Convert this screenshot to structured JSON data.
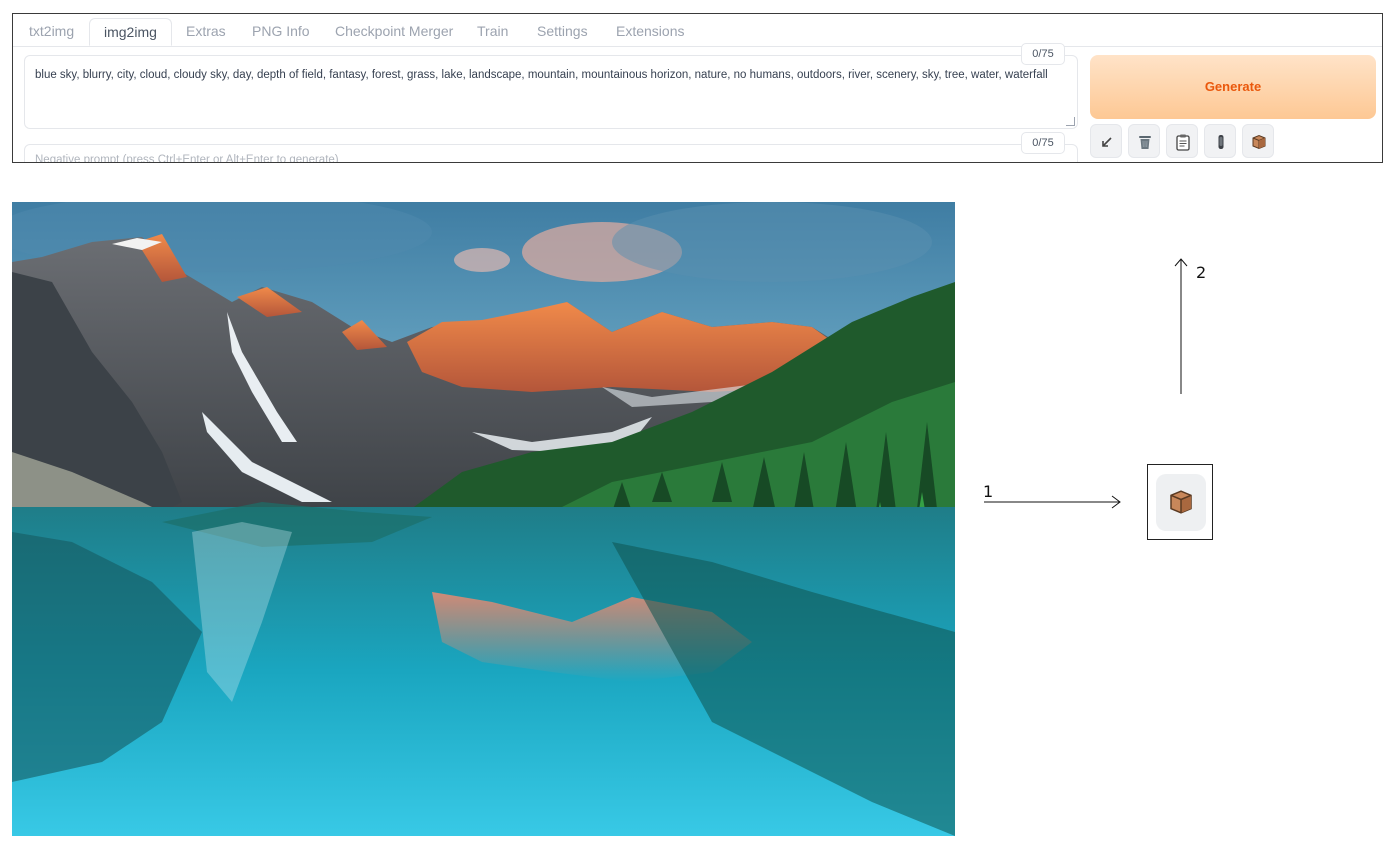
{
  "tabs": [
    {
      "label": "txt2img"
    },
    {
      "label": "img2img",
      "active": true
    },
    {
      "label": "Extras"
    },
    {
      "label": "PNG Info"
    },
    {
      "label": "Checkpoint Merger"
    },
    {
      "label": "Train"
    },
    {
      "label": "Settings"
    },
    {
      "label": "Extensions"
    }
  ],
  "prompt": {
    "value": "blue sky, blurry, city, cloud, cloudy sky, day, depth of field, fantasy, forest, grass, lake, landscape, mountain, mountainous horizon, nature, no humans, outdoors, river, scenery, sky, tree, water, waterfall",
    "token_counter": "0/75"
  },
  "negative_prompt": {
    "placeholder": "Negative prompt (press Ctrl+Enter or Alt+Enter to generate)",
    "token_counter": "0/75"
  },
  "generate": {
    "label": "Generate",
    "accent": "#ea580c"
  },
  "tools": [
    {
      "icon": "arrow-diagonal-icon"
    },
    {
      "icon": "trash-icon"
    },
    {
      "icon": "clipboard-icon"
    },
    {
      "icon": "pencil-icon"
    },
    {
      "icon": "cube-icon"
    }
  ],
  "annotations": {
    "label_1": "1",
    "label_2": "2",
    "zoomed_icon": "cube-icon"
  }
}
